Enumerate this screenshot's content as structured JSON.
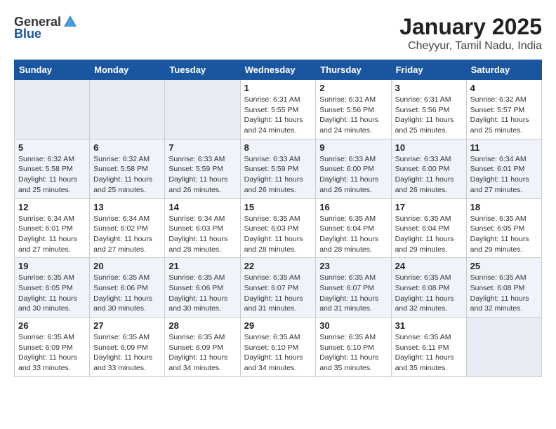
{
  "header": {
    "logo_general": "General",
    "logo_blue": "Blue",
    "month_title": "January 2025",
    "location": "Cheyyur, Tamil Nadu, India"
  },
  "days_of_week": [
    "Sunday",
    "Monday",
    "Tuesday",
    "Wednesday",
    "Thursday",
    "Friday",
    "Saturday"
  ],
  "weeks": [
    [
      {
        "day": "",
        "sunrise": "",
        "sunset": "",
        "daylight": "",
        "empty": true
      },
      {
        "day": "",
        "sunrise": "",
        "sunset": "",
        "daylight": "",
        "empty": true
      },
      {
        "day": "",
        "sunrise": "",
        "sunset": "",
        "daylight": "",
        "empty": true
      },
      {
        "day": "1",
        "sunrise": "Sunrise: 6:31 AM",
        "sunset": "Sunset: 5:55 PM",
        "daylight": "Daylight: 11 hours and 24 minutes."
      },
      {
        "day": "2",
        "sunrise": "Sunrise: 6:31 AM",
        "sunset": "Sunset: 5:56 PM",
        "daylight": "Daylight: 11 hours and 24 minutes."
      },
      {
        "day": "3",
        "sunrise": "Sunrise: 6:31 AM",
        "sunset": "Sunset: 5:56 PM",
        "daylight": "Daylight: 11 hours and 25 minutes."
      },
      {
        "day": "4",
        "sunrise": "Sunrise: 6:32 AM",
        "sunset": "Sunset: 5:57 PM",
        "daylight": "Daylight: 11 hours and 25 minutes."
      }
    ],
    [
      {
        "day": "5",
        "sunrise": "Sunrise: 6:32 AM",
        "sunset": "Sunset: 5:58 PM",
        "daylight": "Daylight: 11 hours and 25 minutes."
      },
      {
        "day": "6",
        "sunrise": "Sunrise: 6:32 AM",
        "sunset": "Sunset: 5:58 PM",
        "daylight": "Daylight: 11 hours and 25 minutes."
      },
      {
        "day": "7",
        "sunrise": "Sunrise: 6:33 AM",
        "sunset": "Sunset: 5:59 PM",
        "daylight": "Daylight: 11 hours and 26 minutes."
      },
      {
        "day": "8",
        "sunrise": "Sunrise: 6:33 AM",
        "sunset": "Sunset: 5:59 PM",
        "daylight": "Daylight: 11 hours and 26 minutes."
      },
      {
        "day": "9",
        "sunrise": "Sunrise: 6:33 AM",
        "sunset": "Sunset: 6:00 PM",
        "daylight": "Daylight: 11 hours and 26 minutes."
      },
      {
        "day": "10",
        "sunrise": "Sunrise: 6:33 AM",
        "sunset": "Sunset: 6:00 PM",
        "daylight": "Daylight: 11 hours and 26 minutes."
      },
      {
        "day": "11",
        "sunrise": "Sunrise: 6:34 AM",
        "sunset": "Sunset: 6:01 PM",
        "daylight": "Daylight: 11 hours and 27 minutes."
      }
    ],
    [
      {
        "day": "12",
        "sunrise": "Sunrise: 6:34 AM",
        "sunset": "Sunset: 6:01 PM",
        "daylight": "Daylight: 11 hours and 27 minutes."
      },
      {
        "day": "13",
        "sunrise": "Sunrise: 6:34 AM",
        "sunset": "Sunset: 6:02 PM",
        "daylight": "Daylight: 11 hours and 27 minutes."
      },
      {
        "day": "14",
        "sunrise": "Sunrise: 6:34 AM",
        "sunset": "Sunset: 6:03 PM",
        "daylight": "Daylight: 11 hours and 28 minutes."
      },
      {
        "day": "15",
        "sunrise": "Sunrise: 6:35 AM",
        "sunset": "Sunset: 6:03 PM",
        "daylight": "Daylight: 11 hours and 28 minutes."
      },
      {
        "day": "16",
        "sunrise": "Sunrise: 6:35 AM",
        "sunset": "Sunset: 6:04 PM",
        "daylight": "Daylight: 11 hours and 28 minutes."
      },
      {
        "day": "17",
        "sunrise": "Sunrise: 6:35 AM",
        "sunset": "Sunset: 6:04 PM",
        "daylight": "Daylight: 11 hours and 29 minutes."
      },
      {
        "day": "18",
        "sunrise": "Sunrise: 6:35 AM",
        "sunset": "Sunset: 6:05 PM",
        "daylight": "Daylight: 11 hours and 29 minutes."
      }
    ],
    [
      {
        "day": "19",
        "sunrise": "Sunrise: 6:35 AM",
        "sunset": "Sunset: 6:05 PM",
        "daylight": "Daylight: 11 hours and 30 minutes."
      },
      {
        "day": "20",
        "sunrise": "Sunrise: 6:35 AM",
        "sunset": "Sunset: 6:06 PM",
        "daylight": "Daylight: 11 hours and 30 minutes."
      },
      {
        "day": "21",
        "sunrise": "Sunrise: 6:35 AM",
        "sunset": "Sunset: 6:06 PM",
        "daylight": "Daylight: 11 hours and 30 minutes."
      },
      {
        "day": "22",
        "sunrise": "Sunrise: 6:35 AM",
        "sunset": "Sunset: 6:07 PM",
        "daylight": "Daylight: 11 hours and 31 minutes."
      },
      {
        "day": "23",
        "sunrise": "Sunrise: 6:35 AM",
        "sunset": "Sunset: 6:07 PM",
        "daylight": "Daylight: 11 hours and 31 minutes."
      },
      {
        "day": "24",
        "sunrise": "Sunrise: 6:35 AM",
        "sunset": "Sunset: 6:08 PM",
        "daylight": "Daylight: 11 hours and 32 minutes."
      },
      {
        "day": "25",
        "sunrise": "Sunrise: 6:35 AM",
        "sunset": "Sunset: 6:08 PM",
        "daylight": "Daylight: 11 hours and 32 minutes."
      }
    ],
    [
      {
        "day": "26",
        "sunrise": "Sunrise: 6:35 AM",
        "sunset": "Sunset: 6:09 PM",
        "daylight": "Daylight: 11 hours and 33 minutes."
      },
      {
        "day": "27",
        "sunrise": "Sunrise: 6:35 AM",
        "sunset": "Sunset: 6:09 PM",
        "daylight": "Daylight: 11 hours and 33 minutes."
      },
      {
        "day": "28",
        "sunrise": "Sunrise: 6:35 AM",
        "sunset": "Sunset: 6:09 PM",
        "daylight": "Daylight: 11 hours and 34 minutes."
      },
      {
        "day": "29",
        "sunrise": "Sunrise: 6:35 AM",
        "sunset": "Sunset: 6:10 PM",
        "daylight": "Daylight: 11 hours and 34 minutes."
      },
      {
        "day": "30",
        "sunrise": "Sunrise: 6:35 AM",
        "sunset": "Sunset: 6:10 PM",
        "daylight": "Daylight: 11 hours and 35 minutes."
      },
      {
        "day": "31",
        "sunrise": "Sunrise: 6:35 AM",
        "sunset": "Sunset: 6:11 PM",
        "daylight": "Daylight: 11 hours and 35 minutes."
      },
      {
        "day": "",
        "sunrise": "",
        "sunset": "",
        "daylight": "",
        "empty": true
      }
    ]
  ]
}
